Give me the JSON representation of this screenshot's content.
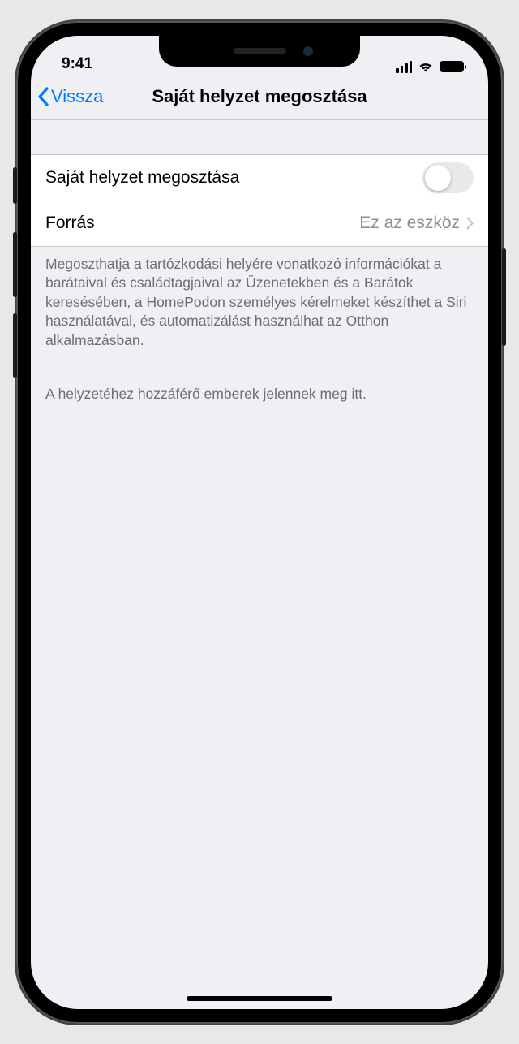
{
  "status": {
    "time": "9:41"
  },
  "nav": {
    "back": "Vissza",
    "title": "Saját helyzet megosztása"
  },
  "rows": {
    "share": {
      "label": "Saját helyzet megosztása",
      "on": false
    },
    "source": {
      "label": "Forrás",
      "value": "Ez az eszköz"
    }
  },
  "footer": {
    "text1": "Megoszthatja a tartózkodási helyére vonatkozó információkat a barátaival és családtagjaival az Üzenetekben és a Barátok keresésében, a HomePodon személyes kérelmeket készíthet a Siri használatával, és automatizálást használhat az Otthon alkalmazásban.",
    "text2": "A helyzetéhez hozzáférő emberek jelennek meg itt."
  }
}
